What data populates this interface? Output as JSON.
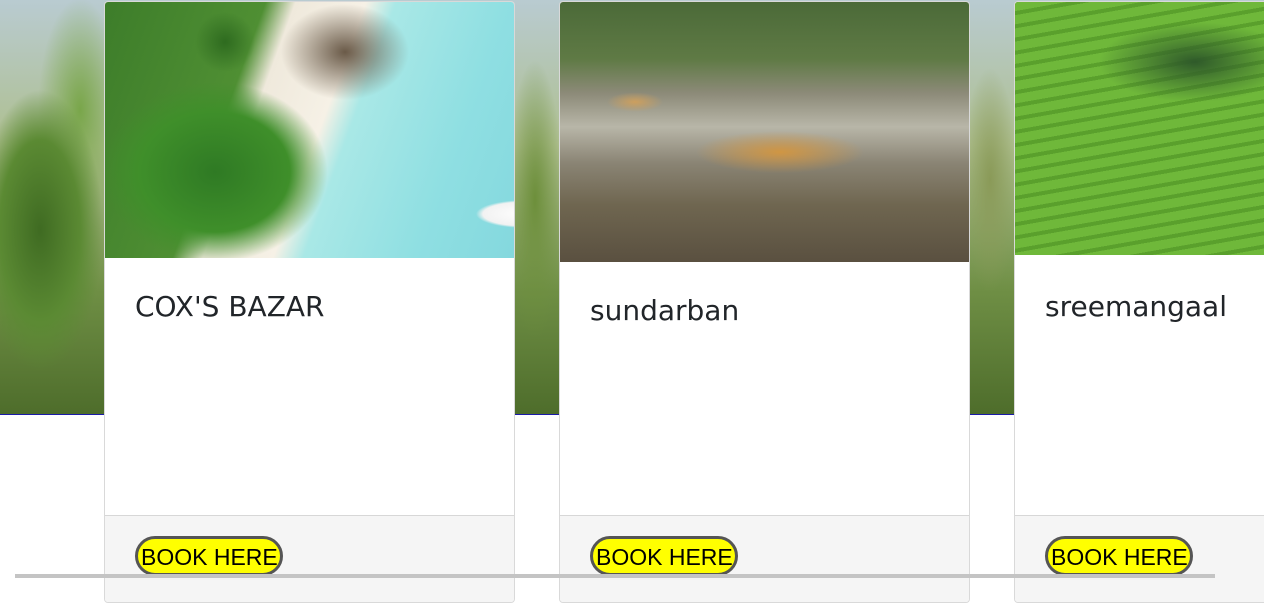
{
  "cards": [
    {
      "title": "COX'S BAZAR",
      "button": "BOOK HERE",
      "image": "beach-seaplane-photo"
    },
    {
      "title": "sundarban",
      "button": "BOOK HERE",
      "image": "deer-mangrove-photo"
    },
    {
      "title": "sreemangaal",
      "button": "BOOK HERE",
      "image": "tea-garden-photo"
    }
  ],
  "colors": {
    "button_bg": "#ffff00",
    "button_border": "#555555",
    "footer_bg": "#f5f5f5",
    "hero_border": "#1a1aa8"
  }
}
